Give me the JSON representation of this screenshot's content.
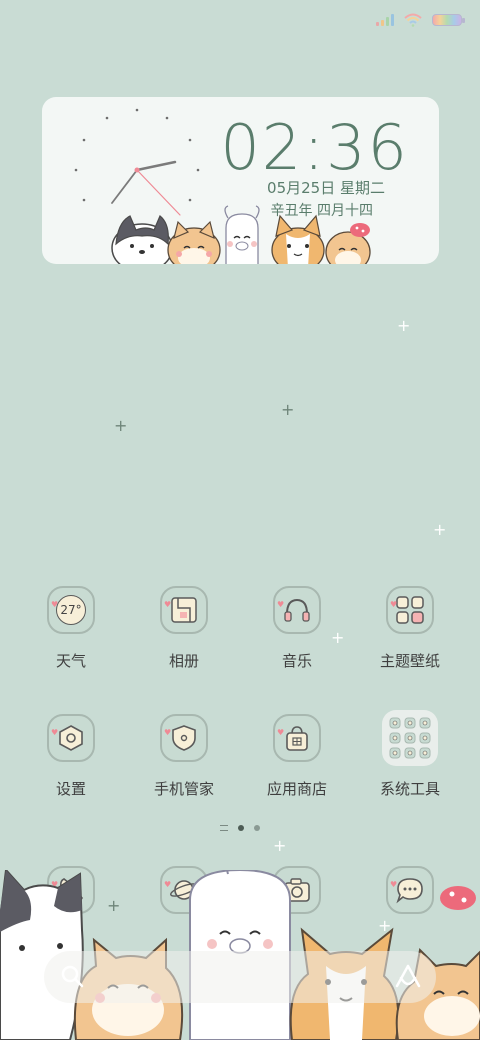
{
  "status_bar": {
    "signal_icon": "signal-icon",
    "wifi_icon": "wifi-icon",
    "battery_icon": "battery-icon"
  },
  "clock_widget": {
    "time": "02:36",
    "date": "05月25日 星期二",
    "lunar_date": "辛丑年 四月十四"
  },
  "apps": [
    {
      "label": "天气",
      "icon": "weather-icon",
      "badge": "27°"
    },
    {
      "label": "相册",
      "icon": "gallery-icon"
    },
    {
      "label": "音乐",
      "icon": "music-icon"
    },
    {
      "label": "主题壁纸",
      "icon": "theme-icon"
    },
    {
      "label": "设置",
      "icon": "settings-icon"
    },
    {
      "label": "手机管家",
      "icon": "phone-manager-icon"
    },
    {
      "label": "应用商店",
      "icon": "app-store-icon"
    },
    {
      "label": "系统工具",
      "icon": "system-tools-folder-icon"
    }
  ],
  "page_indicator": {
    "pages": 2,
    "active": 1
  },
  "dock": [
    {
      "icon": "phone-icon"
    },
    {
      "icon": "browser-icon"
    },
    {
      "icon": "camera-icon"
    },
    {
      "icon": "messages-icon"
    }
  ],
  "search_bar": {
    "search_icon": "search-icon",
    "assistant_icon": "assistant-icon"
  },
  "colors": {
    "background": "#c9dcd4",
    "accent": "#5a7d6c",
    "heart": "#ef8a95"
  }
}
